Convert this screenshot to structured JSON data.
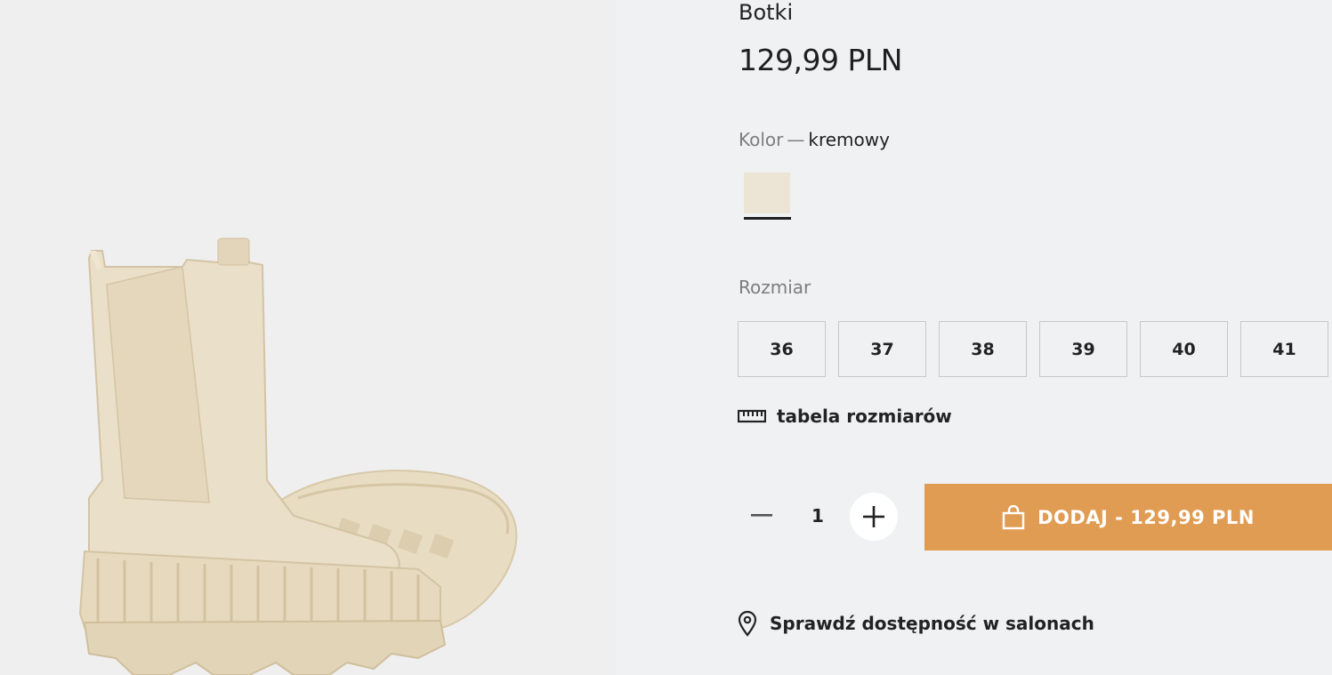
{
  "product": {
    "name": "Botki",
    "price": "129,99 PLN"
  },
  "color": {
    "label": "Kolor",
    "separator": "—",
    "value": "kremowy",
    "swatch_hex": "#ece5d6"
  },
  "size": {
    "label": "Rozmiar",
    "options": [
      "36",
      "37",
      "38",
      "39",
      "40",
      "41"
    ],
    "table_link": "tabela rozmiarów",
    "table_icon": "ruler-icon"
  },
  "quantity": {
    "value": "1",
    "minus_icon": "minus-icon",
    "plus_icon": "plus-icon"
  },
  "cart": {
    "button_label": "DODAJ - 129,99 PLN",
    "icon": "shopping-bag-icon",
    "accent": "#e19c54"
  },
  "availability": {
    "label": "Sprawdź dostępność w salonach",
    "icon": "location-pin-icon"
  }
}
